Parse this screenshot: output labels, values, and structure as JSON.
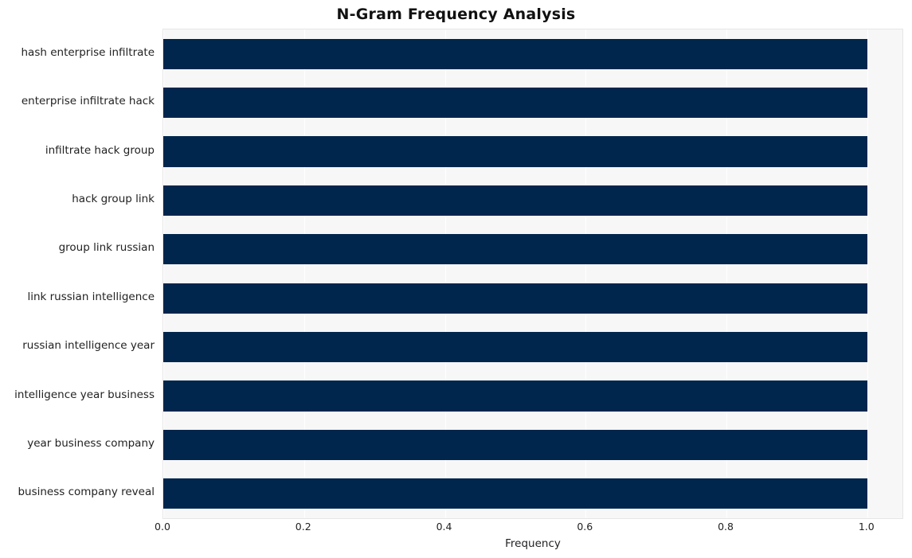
{
  "chart_data": {
    "type": "bar",
    "orientation": "horizontal",
    "title": "N-Gram Frequency Analysis",
    "xlabel": "Frequency",
    "ylabel": "",
    "xlim": [
      0.0,
      1.05
    ],
    "xticks": [
      "0.0",
      "0.2",
      "0.4",
      "0.6",
      "0.8",
      "1.0"
    ],
    "xtick_values": [
      0.0,
      0.2,
      0.4,
      0.6,
      0.8,
      1.0
    ],
    "grid": true,
    "legend": null,
    "bar_color": "#00264d",
    "plot_background": "#f7f7f7",
    "categories": [
      "hash enterprise infiltrate",
      "enterprise infiltrate hack",
      "infiltrate hack group",
      "hack group link",
      "group link russian",
      "link russian intelligence",
      "russian intelligence year",
      "intelligence year business",
      "year business company",
      "business company reveal"
    ],
    "values": [
      1.0,
      1.0,
      1.0,
      1.0,
      1.0,
      1.0,
      1.0,
      1.0,
      1.0,
      1.0
    ]
  }
}
